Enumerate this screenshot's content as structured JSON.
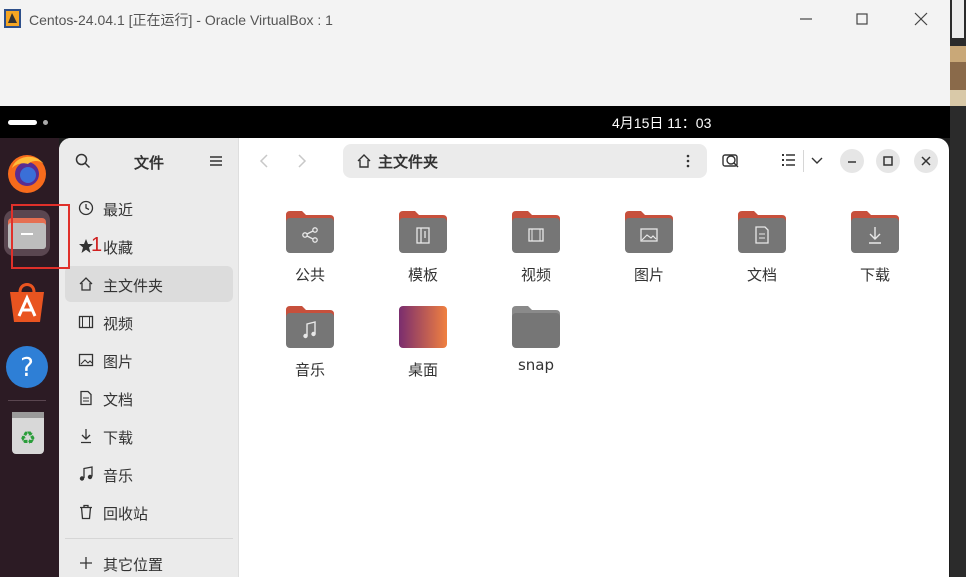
{
  "vbox": {
    "title": "Centos-24.04.1 [正在运行] - Oracle VirtualBox : 1"
  },
  "topbar": {
    "clock": "4月15日  11：03"
  },
  "annotation": {
    "number": "1"
  },
  "dock": {
    "items": [
      {
        "name": "firefox-icon"
      },
      {
        "name": "files-icon"
      },
      {
        "name": "app-center-icon"
      },
      {
        "name": "help-icon"
      },
      {
        "name": "trash-icon"
      }
    ]
  },
  "sidebar": {
    "title": "文件",
    "items": [
      {
        "label": "最近",
        "icon": "clock-icon"
      },
      {
        "label": "收藏",
        "icon": "star-icon"
      },
      {
        "label": "主文件夹",
        "icon": "home-icon"
      },
      {
        "label": "视频",
        "icon": "video-icon"
      },
      {
        "label": "图片",
        "icon": "image-icon"
      },
      {
        "label": "文档",
        "icon": "document-icon"
      },
      {
        "label": "下载",
        "icon": "download-icon"
      },
      {
        "label": "音乐",
        "icon": "music-icon"
      },
      {
        "label": "回收站",
        "icon": "trash-icon"
      },
      {
        "label": "其它位置",
        "icon": "plus-icon"
      }
    ]
  },
  "pathbar": {
    "label": "主文件夹"
  },
  "files": [
    {
      "label": "公共",
      "icon": "share"
    },
    {
      "label": "模板",
      "icon": "template"
    },
    {
      "label": "视频",
      "icon": "video"
    },
    {
      "label": "图片",
      "icon": "image"
    },
    {
      "label": "文档",
      "icon": "document"
    },
    {
      "label": "下载",
      "icon": "download"
    },
    {
      "label": "音乐",
      "icon": "music"
    },
    {
      "label": "桌面",
      "icon": "desktop"
    },
    {
      "label": "snap",
      "icon": "none"
    }
  ],
  "colors": {
    "folder_tab": "#c7503c",
    "folder_body": "#767676",
    "dock_bg": "#2c1b24",
    "highlight": "#e0302a"
  }
}
